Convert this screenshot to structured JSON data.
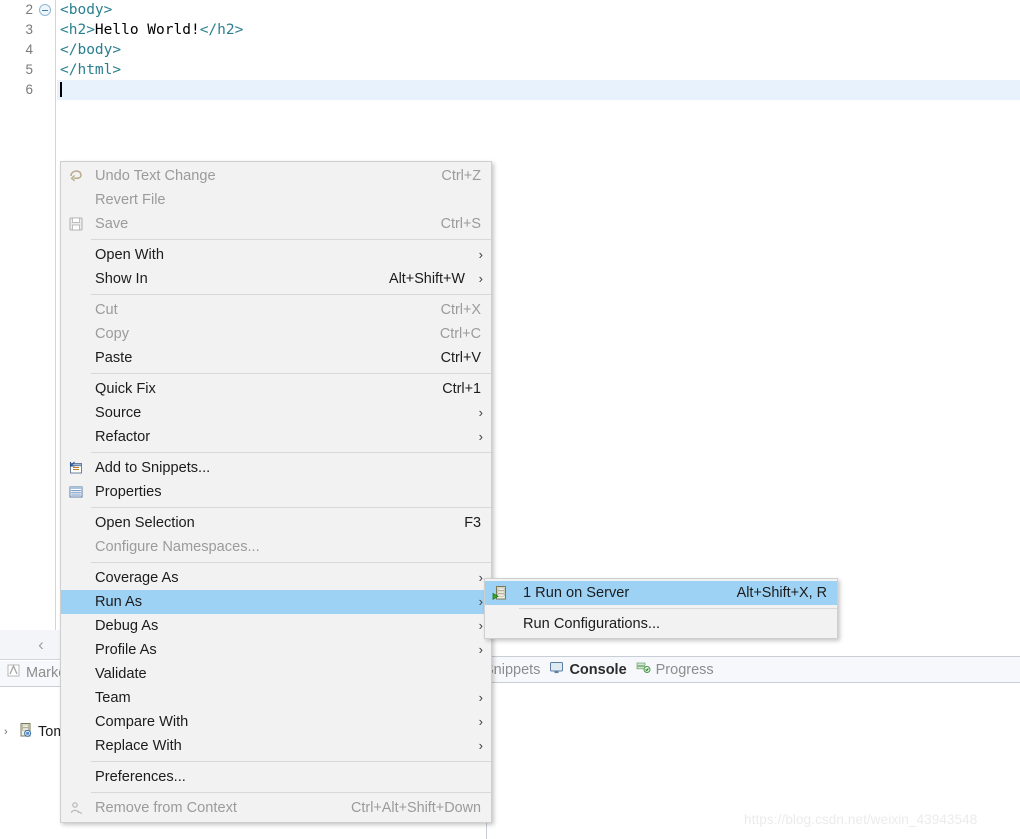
{
  "editor": {
    "lines": [
      {
        "num": "2",
        "fold": true,
        "segments": [
          {
            "t": "tag",
            "s": "<body>"
          }
        ]
      },
      {
        "num": "3",
        "fold": false,
        "segments": [
          {
            "t": "tag",
            "s": "<h2>"
          },
          {
            "t": "txt",
            "s": "Hello World!"
          },
          {
            "t": "tag",
            "s": "</h2>"
          }
        ]
      },
      {
        "num": "4",
        "fold": false,
        "segments": [
          {
            "t": "tag",
            "s": "</body>"
          }
        ]
      },
      {
        "num": "5",
        "fold": false,
        "segments": [
          {
            "t": "tag",
            "s": "</html>"
          }
        ]
      },
      {
        "num": "6",
        "fold": false,
        "current": true,
        "caret": true,
        "segments": []
      }
    ],
    "tag_color": "#2a7f8f",
    "text_color": "#000000",
    "current_line_color": "#e8f2fc"
  },
  "bottom_left": {
    "collapse_arrow": "‹",
    "tab_label": "Markers",
    "tab_icon": "markers-icon",
    "tree_arrow": "›",
    "server_label": "Tom",
    "server_icon": "server-icon"
  },
  "bottom_right": {
    "tabs": [
      {
        "label": "Snippets",
        "icon": "snippets-icon",
        "active": false
      },
      {
        "label": "Console",
        "icon": "console-icon",
        "active": true
      },
      {
        "label": "Progress",
        "icon": "progress-icon",
        "active": false
      }
    ]
  },
  "watermark": "https://blog.csdn.net/weixin_43943548",
  "context_menu": {
    "items": [
      {
        "kind": "item",
        "label": "Undo Text Change",
        "accel": "Ctrl+Z",
        "icon": "undo-icon",
        "disabled": true,
        "submenu": false
      },
      {
        "kind": "item",
        "label": "Revert File",
        "accel": "",
        "icon": "",
        "disabled": true,
        "submenu": false
      },
      {
        "kind": "item",
        "label": "Save",
        "accel": "Ctrl+S",
        "icon": "save-icon",
        "disabled": true,
        "submenu": false
      },
      {
        "kind": "sep"
      },
      {
        "kind": "item",
        "label": "Open With",
        "accel": "",
        "icon": "",
        "disabled": false,
        "submenu": true
      },
      {
        "kind": "item",
        "label": "Show In",
        "accel": "Alt+Shift+W",
        "icon": "",
        "disabled": false,
        "submenu": true
      },
      {
        "kind": "sep"
      },
      {
        "kind": "item",
        "label": "Cut",
        "accel": "Ctrl+X",
        "icon": "",
        "disabled": true,
        "submenu": false
      },
      {
        "kind": "item",
        "label": "Copy",
        "accel": "Ctrl+C",
        "icon": "",
        "disabled": true,
        "submenu": false
      },
      {
        "kind": "item",
        "label": "Paste",
        "accel": "Ctrl+V",
        "icon": "",
        "disabled": false,
        "submenu": false
      },
      {
        "kind": "sep"
      },
      {
        "kind": "item",
        "label": "Quick Fix",
        "accel": "Ctrl+1",
        "icon": "",
        "disabled": false,
        "submenu": false
      },
      {
        "kind": "item",
        "label": "Source",
        "accel": "",
        "icon": "",
        "disabled": false,
        "submenu": true
      },
      {
        "kind": "item",
        "label": "Refactor",
        "accel": "",
        "icon": "",
        "disabled": false,
        "submenu": true
      },
      {
        "kind": "sep"
      },
      {
        "kind": "item",
        "label": "Add to Snippets...",
        "accel": "",
        "icon": "snippets-add-icon",
        "disabled": false,
        "submenu": false
      },
      {
        "kind": "item",
        "label": "Properties",
        "accel": "",
        "icon": "properties-icon",
        "disabled": false,
        "submenu": false
      },
      {
        "kind": "sep"
      },
      {
        "kind": "item",
        "label": "Open Selection",
        "accel": "F3",
        "icon": "",
        "disabled": false,
        "submenu": false
      },
      {
        "kind": "item",
        "label": "Configure Namespaces...",
        "accel": "",
        "icon": "",
        "disabled": true,
        "submenu": false
      },
      {
        "kind": "sep"
      },
      {
        "kind": "item",
        "label": "Coverage As",
        "accel": "",
        "icon": "",
        "disabled": false,
        "submenu": true
      },
      {
        "kind": "item",
        "label": "Run As",
        "accel": "",
        "icon": "",
        "disabled": false,
        "submenu": true,
        "selected": true
      },
      {
        "kind": "item",
        "label": "Debug As",
        "accel": "",
        "icon": "",
        "disabled": false,
        "submenu": true
      },
      {
        "kind": "item",
        "label": "Profile As",
        "accel": "",
        "icon": "",
        "disabled": false,
        "submenu": true
      },
      {
        "kind": "item",
        "label": "Validate",
        "accel": "",
        "icon": "",
        "disabled": false,
        "submenu": false
      },
      {
        "kind": "item",
        "label": "Team",
        "accel": "",
        "icon": "",
        "disabled": false,
        "submenu": true
      },
      {
        "kind": "item",
        "label": "Compare With",
        "accel": "",
        "icon": "",
        "disabled": false,
        "submenu": true
      },
      {
        "kind": "item",
        "label": "Replace With",
        "accel": "",
        "icon": "",
        "disabled": false,
        "submenu": true
      },
      {
        "kind": "sep"
      },
      {
        "kind": "item",
        "label": "Preferences...",
        "accel": "",
        "icon": "",
        "disabled": false,
        "submenu": false
      },
      {
        "kind": "sep"
      },
      {
        "kind": "item",
        "label": "Remove from Context",
        "accel": "Ctrl+Alt+Shift+Down",
        "icon": "remove-context-icon",
        "disabled": true,
        "submenu": false
      }
    ]
  },
  "sub_menu": {
    "items": [
      {
        "kind": "item",
        "label": "1 Run on Server",
        "accel": "Alt+Shift+X, R",
        "icon": "run-on-server-icon",
        "disabled": false,
        "submenu": false,
        "selected": true
      },
      {
        "kind": "sep"
      },
      {
        "kind": "item",
        "label": "Run Configurations...",
        "accel": "",
        "icon": "",
        "disabled": false,
        "submenu": false
      }
    ]
  },
  "colors": {
    "menu_bg": "#f2f2f2",
    "menu_border": "#cfcfcf",
    "highlight": "#9ed2f5",
    "disabled_text": "#9b9b9b",
    "enabled_text": "#1c1c1c",
    "separator": "#d8d8d8"
  }
}
